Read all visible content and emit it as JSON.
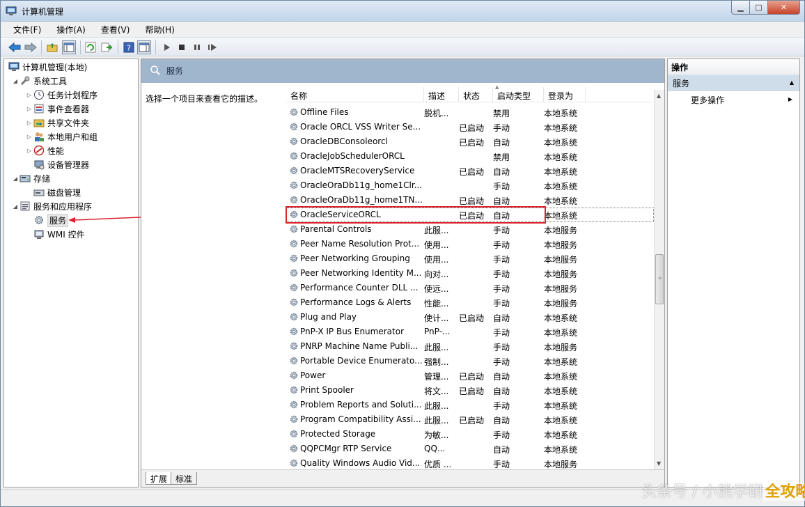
{
  "window": {
    "title": "计算机管理"
  },
  "menu": [
    "文件(F)",
    "操作(A)",
    "查看(V)",
    "帮助(H)"
  ],
  "tree": {
    "root": "计算机管理(本地)",
    "items": [
      {
        "label": "系统工具",
        "level": 1,
        "expanded": true
      },
      {
        "label": "任务计划程序",
        "level": 2
      },
      {
        "label": "事件查看器",
        "level": 2
      },
      {
        "label": "共享文件夹",
        "level": 2
      },
      {
        "label": "本地用户和组",
        "level": 2
      },
      {
        "label": "性能",
        "level": 2
      },
      {
        "label": "设备管理器",
        "level": 2
      },
      {
        "label": "存储",
        "level": 1,
        "expanded": true
      },
      {
        "label": "磁盘管理",
        "level": 2
      },
      {
        "label": "服务和应用程序",
        "level": 1,
        "expanded": true
      },
      {
        "label": "服务",
        "level": 2,
        "selected": true
      },
      {
        "label": "WMI 控件",
        "level": 2
      }
    ]
  },
  "services_header": {
    "title": "服务"
  },
  "description_hint": "选择一个项目来查看它的描述。",
  "columns": {
    "name": "名称",
    "desc": "描述",
    "status": "状态",
    "startup": "启动类型",
    "logon": "登录为"
  },
  "rows": [
    {
      "name": "Offline Files",
      "desc": "脱机...",
      "status": "",
      "startup": "禁用",
      "logon": "本地系统"
    },
    {
      "name": "Oracle ORCL VSS Writer Se...",
      "desc": "",
      "status": "已启动",
      "startup": "手动",
      "logon": "本地系统"
    },
    {
      "name": "OracleDBConsoleorcl",
      "desc": "",
      "status": "已启动",
      "startup": "自动",
      "logon": "本地系统"
    },
    {
      "name": "OracleJobSchedulerORCL",
      "desc": "",
      "status": "",
      "startup": "禁用",
      "logon": "本地系统"
    },
    {
      "name": "OracleMTSRecoveryService",
      "desc": "",
      "status": "已启动",
      "startup": "自动",
      "logon": "本地系统"
    },
    {
      "name": "OracleOraDb11g_home1Clr...",
      "desc": "",
      "status": "",
      "startup": "手动",
      "logon": "本地系统"
    },
    {
      "name": "OracleOraDb11g_home1TN...",
      "desc": "",
      "status": "已启动",
      "startup": "自动",
      "logon": "本地系统"
    },
    {
      "name": "OracleServiceORCL",
      "desc": "",
      "status": "已启动",
      "startup": "自动",
      "logon": "本地系统",
      "selected": true
    },
    {
      "name": "Parental Controls",
      "desc": "此服...",
      "status": "",
      "startup": "手动",
      "logon": "本地服务"
    },
    {
      "name": "Peer Name Resolution Prot...",
      "desc": "使用...",
      "status": "",
      "startup": "手动",
      "logon": "本地服务"
    },
    {
      "name": "Peer Networking Grouping",
      "desc": "使用...",
      "status": "",
      "startup": "手动",
      "logon": "本地服务"
    },
    {
      "name": "Peer Networking Identity M...",
      "desc": "向对...",
      "status": "",
      "startup": "手动",
      "logon": "本地服务"
    },
    {
      "name": "Performance Counter DLL ...",
      "desc": "使远...",
      "status": "",
      "startup": "手动",
      "logon": "本地服务"
    },
    {
      "name": "Performance Logs & Alerts",
      "desc": "性能...",
      "status": "",
      "startup": "手动",
      "logon": "本地服务"
    },
    {
      "name": "Plug and Play",
      "desc": "使计...",
      "status": "已启动",
      "startup": "自动",
      "logon": "本地系统"
    },
    {
      "name": "PnP-X IP Bus Enumerator",
      "desc": "PnP-...",
      "status": "",
      "startup": "手动",
      "logon": "本地系统"
    },
    {
      "name": "PNRP Machine Name Publi...",
      "desc": "此服...",
      "status": "",
      "startup": "手动",
      "logon": "本地服务"
    },
    {
      "name": "Portable Device Enumerato...",
      "desc": "强制...",
      "status": "",
      "startup": "手动",
      "logon": "本地系统"
    },
    {
      "name": "Power",
      "desc": "管理...",
      "status": "已启动",
      "startup": "自动",
      "logon": "本地系统"
    },
    {
      "name": "Print Spooler",
      "desc": "将文...",
      "status": "已启动",
      "startup": "自动",
      "logon": "本地系统"
    },
    {
      "name": "Problem Reports and Soluti...",
      "desc": "此服...",
      "status": "",
      "startup": "手动",
      "logon": "本地系统"
    },
    {
      "name": "Program Compatibility Assi...",
      "desc": "此服...",
      "status": "已启动",
      "startup": "自动",
      "logon": "本地系统"
    },
    {
      "name": "Protected Storage",
      "desc": "为敏...",
      "status": "",
      "startup": "手动",
      "logon": "本地系统"
    },
    {
      "name": "QQPCMgr RTP Service",
      "desc": "QQ...",
      "status": "",
      "startup": "自动",
      "logon": "本地系统"
    },
    {
      "name": "Quality Windows Audio Vid...",
      "desc": "优质 ...",
      "status": "",
      "startup": "手动",
      "logon": "本地服务"
    }
  ],
  "tabs": [
    "扩展",
    "标准"
  ],
  "actions": {
    "header": "操作",
    "section": "服务",
    "more": "更多操作"
  },
  "watermark": {
    "text": "头条号 / 小熊学研",
    "logo": "全攻略"
  },
  "colors": {
    "highlight": "#d9242e",
    "header_band": "#9fb6cd",
    "action_section": "#cfdcea"
  }
}
